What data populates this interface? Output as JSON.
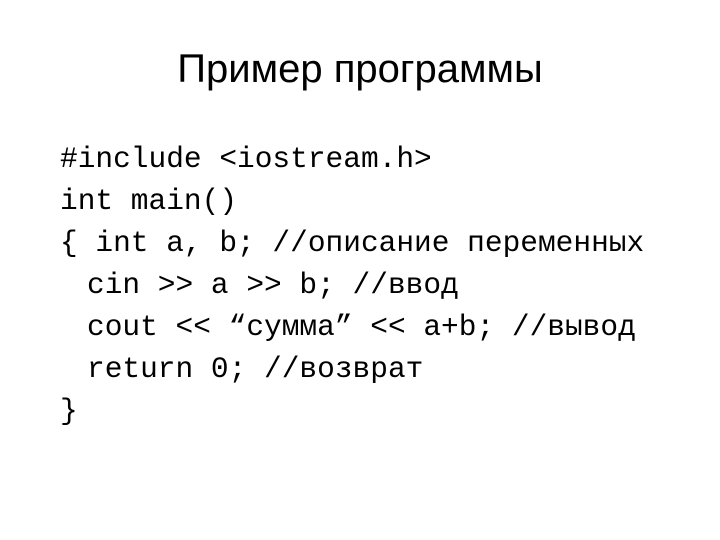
{
  "slide": {
    "title": "Пример программы",
    "code_lines": [
      {
        "text": "#include <iostream.h>",
        "indent": false
      },
      {
        "text": "int main()",
        "indent": false
      },
      {
        "text": "{ int a, b; //описание переменных",
        "indent": false
      },
      {
        "text": "cin >> a >> b; //ввод",
        "indent": true
      },
      {
        "text": "cout << “сумма” << a+b; //вывод",
        "indent": true
      },
      {
        "text": "return 0; //возврат",
        "indent": true
      },
      {
        "text": "}",
        "indent": false
      }
    ]
  }
}
